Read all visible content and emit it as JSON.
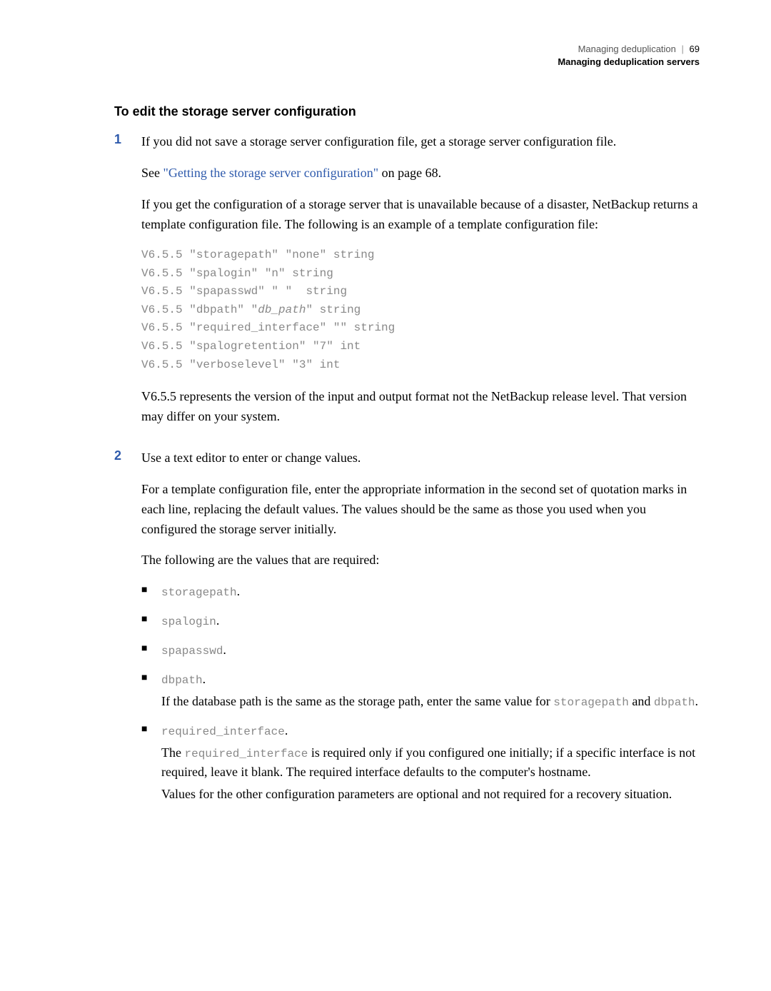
{
  "header": {
    "group": "Managing deduplication",
    "page": "69",
    "subtitle": "Managing deduplication servers"
  },
  "section_title": "To edit the storage server configuration",
  "step1": {
    "num": "1",
    "p1": "If you did not save a storage server configuration file, get a storage server configuration file.",
    "see_prefix": "See ",
    "see_link": "\"Getting the storage server configuration\"",
    "see_suffix": " on page 68.",
    "p3": "If you get the configuration of a storage server that is unavailable because of a disaster, NetBackup returns a template configuration file. The following is an example of a template configuration file:",
    "code_l1": "V6.5.5 \"storagepath\" \"none\" string",
    "code_l2": "V6.5.5 \"spalogin\" \"n\" string",
    "code_l3": "V6.5.5 \"spapasswd\" \" \"  string",
    "code_l4a": "V6.5.5 \"dbpath\" \"",
    "code_l4b": "db_path",
    "code_l4c": "\" string",
    "code_l5": "V6.5.5 \"required_interface\" \"\" string",
    "code_l6": "V6.5.5 \"spalogretention\" \"7\" int",
    "code_l7": "V6.5.5 \"verboselevel\" \"3\" int",
    "p4": "V6.5.5 represents the version of the input and output format not the NetBackup release level. That version may differ on your system."
  },
  "step2": {
    "num": "2",
    "p1": "Use a text editor to enter or change values.",
    "p2": "For a template configuration file, enter the appropriate information in the second set of quotation marks in each line, replacing the default values. The values should be the same as those you used when you configured the storage server initially.",
    "p3": "The following are the values that are required:",
    "b1": "storagepath",
    "b2": "spalogin",
    "b3": "spapasswd",
    "b4": "dbpath",
    "b4_sub_a": "If the database path is the same as the storage path, enter the same value for ",
    "b4_sub_m1": "storagepath",
    "b4_sub_mid": " and ",
    "b4_sub_m2": "dbpath",
    "b5": "required_interface",
    "b5_sub1_a": "The ",
    "b5_sub1_m": "required_interface",
    "b5_sub1_b": " is required only if you configured one initially; if a specific interface is not required, leave it blank. The required interface defaults to the computer's hostname.",
    "b5_sub2": "Values for the other configuration parameters are optional and not required for a recovery situation."
  }
}
